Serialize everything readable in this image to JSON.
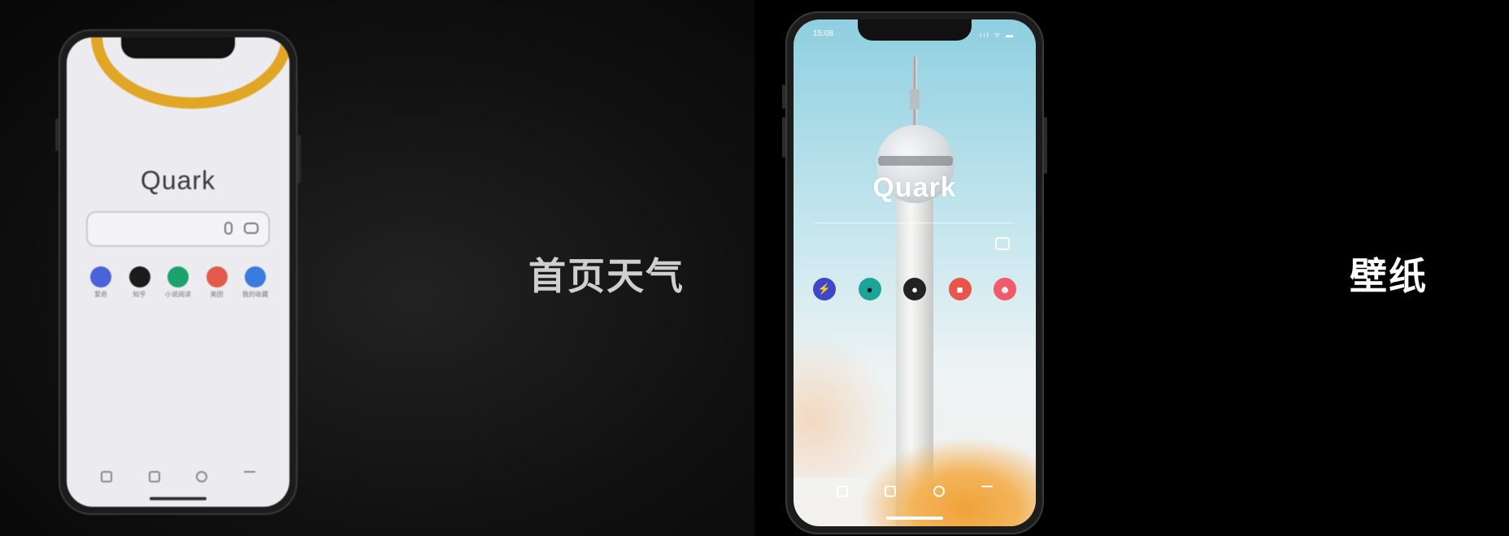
{
  "captions": {
    "left": "首页天气",
    "right": "壁纸"
  },
  "phone_left": {
    "logo": "Quark",
    "shortcuts": [
      {
        "label": "爱奇",
        "color": "#4a63d8",
        "icon": "info-icon"
      },
      {
        "label": "知乎",
        "color": "#1c1c1c",
        "icon": "avatar-icon"
      },
      {
        "label": "小说阅读",
        "color": "#1aa36b",
        "icon": "robot-icon"
      },
      {
        "label": "美团",
        "color": "#e25a4a",
        "icon": "app-icon"
      },
      {
        "label": "我的收藏",
        "color": "#3b7be0",
        "icon": "bookmark-icon"
      }
    ]
  },
  "phone_right": {
    "time": "15:08",
    "status_icons": "ııl ᯤ ▬",
    "logo": "Quark",
    "shortcuts": [
      {
        "color": "#3d47c8",
        "icon": "lightning-icon",
        "glyph": "⚡"
      },
      {
        "color": "#1ca39a",
        "icon": "robot-icon",
        "glyph": "●"
      },
      {
        "color": "#222222",
        "icon": "avatar-icon",
        "glyph": "●"
      },
      {
        "color": "#e8554a",
        "icon": "app-icon",
        "glyph": "■"
      },
      {
        "color": "#f05a6a",
        "icon": "face-icon",
        "glyph": "☻"
      }
    ]
  }
}
